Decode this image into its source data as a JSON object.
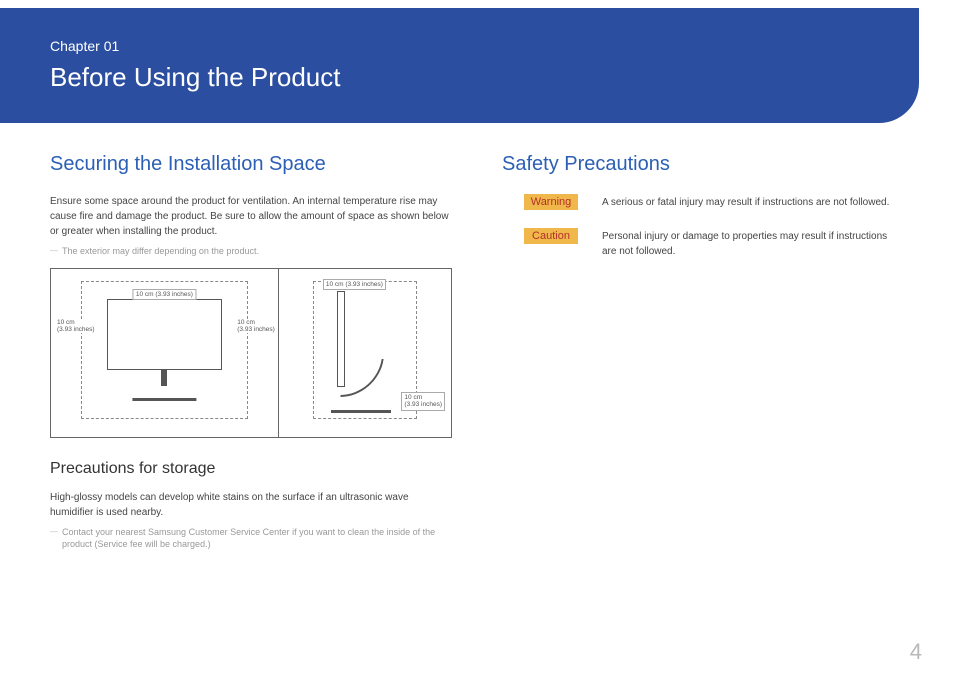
{
  "header": {
    "chapter_label": "Chapter 01",
    "chapter_title": "Before Using the Product"
  },
  "left": {
    "heading": "Securing the Installation Space",
    "intro": "Ensure some space around the product for ventilation. An internal temperature rise may cause fire and damage the product. Be sure to allow the amount of space as shown below or greater when installing the product.",
    "footnote1": "The exterior may differ depending on the product.",
    "diagram": {
      "top_label": "10 cm (3.93 inches)",
      "left_label_a": "10 cm",
      "left_label_b": "(3.93 inches)",
      "right_label_a": "10 cm",
      "right_label_b": "(3.93 inches)",
      "side_top_label": "10 cm (3.93 inches)",
      "side_right_label_a": "10 cm",
      "side_right_label_b": "(3.93 inches)"
    },
    "sub_heading": "Precautions for storage",
    "sub_body": "High-glossy models can develop white stains on the surface if an ultrasonic wave humidifier is used nearby.",
    "footnote2": "Contact your nearest Samsung Customer Service Center if you want to clean the inside of the product (Service fee will be charged.)"
  },
  "right": {
    "heading": "Safety Precautions",
    "warning_label": "Warning",
    "warning_text": "A serious or fatal injury may result if instructions are not followed.",
    "caution_label": "Caution",
    "caution_text": "Personal injury or damage to properties may result if instructions are not followed."
  },
  "page_number": "4"
}
